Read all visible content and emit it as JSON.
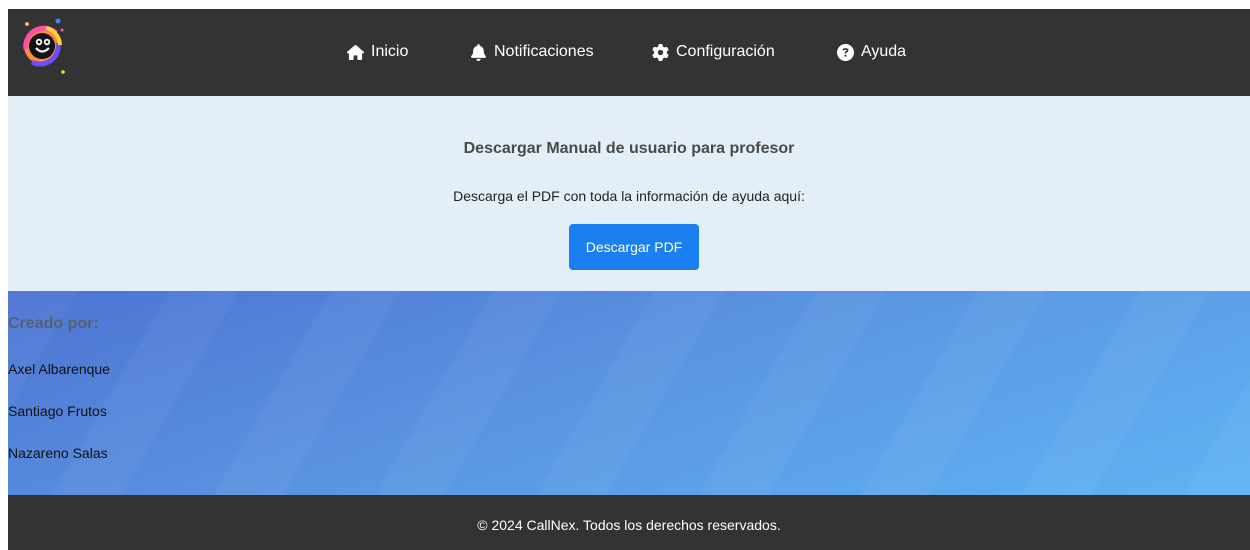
{
  "navbar": {
    "items": [
      {
        "label": "Inicio",
        "icon": "home-icon"
      },
      {
        "label": "Notificaciones",
        "icon": "bell-icon"
      },
      {
        "label": "Configuración",
        "icon": "gear-icon"
      },
      {
        "label": "Ayuda",
        "icon": "question-circle-icon"
      }
    ]
  },
  "help": {
    "title": "Descargar Manual de usuario para profesor",
    "text": "Descarga el PDF con toda la información de ayuda aquí:",
    "button_label": "Descargar PDF"
  },
  "credits": {
    "heading": "Creado por:",
    "names": [
      "Axel Albarenque",
      "Santiago Frutos",
      "Nazareno Salas"
    ]
  },
  "footer": {
    "text": "© 2024 CallNex. Todos los derechos reservados."
  },
  "colors": {
    "navbar_bg": "#333333",
    "help_bg": "#e4eef8",
    "button_bg": "#1a7ff0",
    "gradient_start": "#4c74d3",
    "gradient_end": "#60b3f3"
  }
}
